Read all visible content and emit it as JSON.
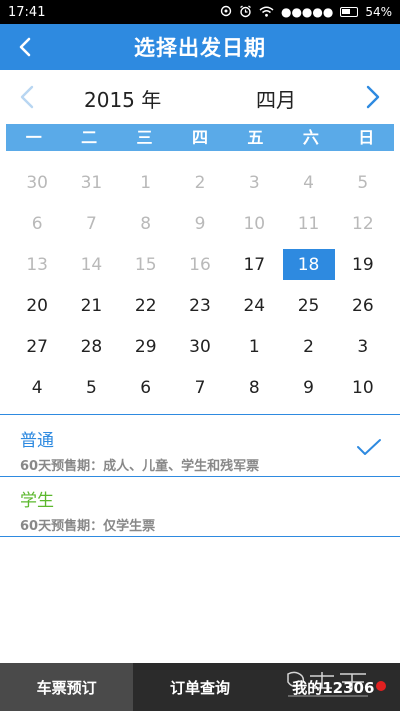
{
  "status_bar": {
    "time": "17:41",
    "signal": "●●●●●",
    "battery": "54%"
  },
  "header": {
    "title": "选择出发日期"
  },
  "calendar": {
    "year_label": "2015 年",
    "month_label": "四月",
    "weekdays": [
      "一",
      "二",
      "三",
      "四",
      "五",
      "六",
      "日"
    ],
    "weeks": [
      [
        {
          "d": "30",
          "disabled": true
        },
        {
          "d": "31",
          "disabled": true
        },
        {
          "d": "1",
          "disabled": true
        },
        {
          "d": "2",
          "disabled": true
        },
        {
          "d": "3",
          "disabled": true
        },
        {
          "d": "4",
          "disabled": true
        },
        {
          "d": "5",
          "disabled": true
        }
      ],
      [
        {
          "d": "6",
          "disabled": true
        },
        {
          "d": "7",
          "disabled": true
        },
        {
          "d": "8",
          "disabled": true
        },
        {
          "d": "9",
          "disabled": true
        },
        {
          "d": "10",
          "disabled": true
        },
        {
          "d": "11",
          "disabled": true
        },
        {
          "d": "12",
          "disabled": true
        }
      ],
      [
        {
          "d": "13",
          "disabled": true
        },
        {
          "d": "14",
          "disabled": true
        },
        {
          "d": "15",
          "disabled": true
        },
        {
          "d": "16",
          "disabled": true
        },
        {
          "d": "17",
          "disabled": false
        },
        {
          "d": "18",
          "disabled": false,
          "selected": true
        },
        {
          "d": "19",
          "disabled": false
        }
      ],
      [
        {
          "d": "20"
        },
        {
          "d": "21"
        },
        {
          "d": "22"
        },
        {
          "d": "23"
        },
        {
          "d": "24"
        },
        {
          "d": "25"
        },
        {
          "d": "26"
        }
      ],
      [
        {
          "d": "27"
        },
        {
          "d": "28"
        },
        {
          "d": "29"
        },
        {
          "d": "30"
        },
        {
          "d": "1"
        },
        {
          "d": "2"
        },
        {
          "d": "3"
        }
      ],
      [
        {
          "d": "4"
        },
        {
          "d": "5"
        },
        {
          "d": "6"
        },
        {
          "d": "7"
        },
        {
          "d": "8"
        },
        {
          "d": "9"
        },
        {
          "d": "10"
        }
      ]
    ]
  },
  "options": [
    {
      "title": "普通",
      "desc": "60天预售期：成人、儿童、学生和残军票",
      "title_color": "#2e8ae0",
      "checked": true
    },
    {
      "title": "学生",
      "desc": "60天预售期：仅学生票",
      "title_color": "#5cb82e",
      "checked": false
    }
  ],
  "tabs": [
    {
      "label": "车票预订",
      "active": true
    },
    {
      "label": "订单查询",
      "active": false
    },
    {
      "label": "我的12306",
      "active": false
    }
  ],
  "colors": {
    "primary": "#2e8ae0",
    "week_header": "#5aaae8",
    "disabled_text": "#b9b9b9",
    "tab_bar": "#2b2b2b",
    "notification_dot": "#e02020"
  }
}
